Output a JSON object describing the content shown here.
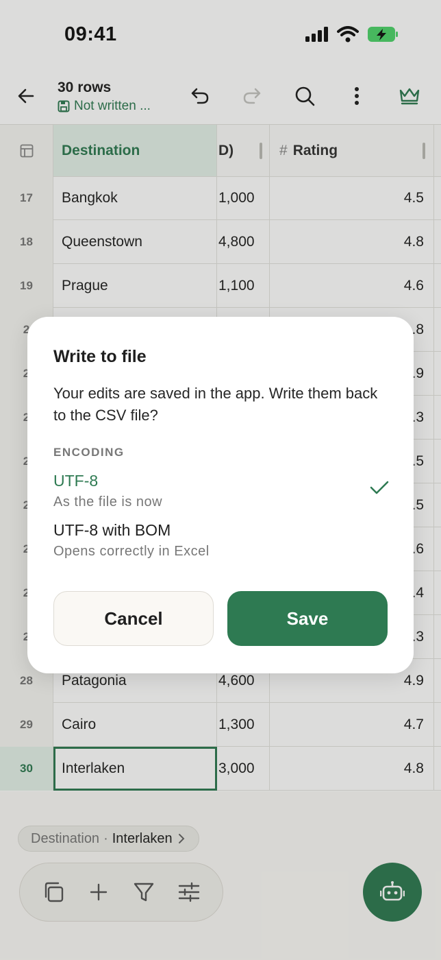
{
  "status_bar": {
    "time": "09:41"
  },
  "toolbar": {
    "title": "30 rows",
    "subtitle": "Not written ..."
  },
  "grid": {
    "headers": {
      "destination": "Destination",
      "cost_fragment": "D)",
      "rating_hash": "#",
      "rating": "Rating"
    },
    "rows": [
      {
        "index": "17",
        "destination": "Bangkok",
        "cost": "1,000",
        "rating": "4.5"
      },
      {
        "index": "18",
        "destination": "Queenstown",
        "cost": "4,800",
        "rating": "4.8"
      },
      {
        "index": "19",
        "destination": "Prague",
        "cost": "1,100",
        "rating": "4.6"
      },
      {
        "index": "2",
        "destination": "",
        "cost": "",
        "rating": ".8"
      },
      {
        "index": "2",
        "destination": "",
        "cost": "",
        "rating": ".9"
      },
      {
        "index": "2",
        "destination": "",
        "cost": "",
        "rating": ".3"
      },
      {
        "index": "2",
        "destination": "",
        "cost": "",
        "rating": ".5"
      },
      {
        "index": "2",
        "destination": "",
        "cost": "",
        "rating": ".5"
      },
      {
        "index": "2",
        "destination": "",
        "cost": "",
        "rating": ".6"
      },
      {
        "index": "2",
        "destination": "",
        "cost": "",
        "rating": ".4"
      },
      {
        "index": "2",
        "destination": "",
        "cost": "",
        "rating": ".3"
      },
      {
        "index": "28",
        "destination": "Patagonia",
        "cost": "4,600",
        "rating": "4.9"
      },
      {
        "index": "29",
        "destination": "Cairo",
        "cost": "1,300",
        "rating": "4.7"
      },
      {
        "index": "30",
        "destination": "Interlaken",
        "cost": "3,000",
        "rating": "4.8"
      }
    ]
  },
  "breadcrumb": {
    "field": "Destination",
    "separator": "·",
    "value": "Interlaken"
  },
  "dialog": {
    "title": "Write to file",
    "message": "Your edits are saved in the app. Write them back to the CSV file?",
    "section_label": "ENCODING",
    "options": [
      {
        "title": "UTF-8",
        "subtitle": "As the file is now",
        "selected": true
      },
      {
        "title": "UTF-8 with BOM",
        "subtitle": "Opens correctly in Excel",
        "selected": false
      }
    ],
    "cancel_label": "Cancel",
    "save_label": "Save"
  },
  "colors": {
    "accent": "#2e7a52",
    "accent_light": "#e4f1e9",
    "text": "#1f1f1f",
    "muted": "#777777"
  }
}
